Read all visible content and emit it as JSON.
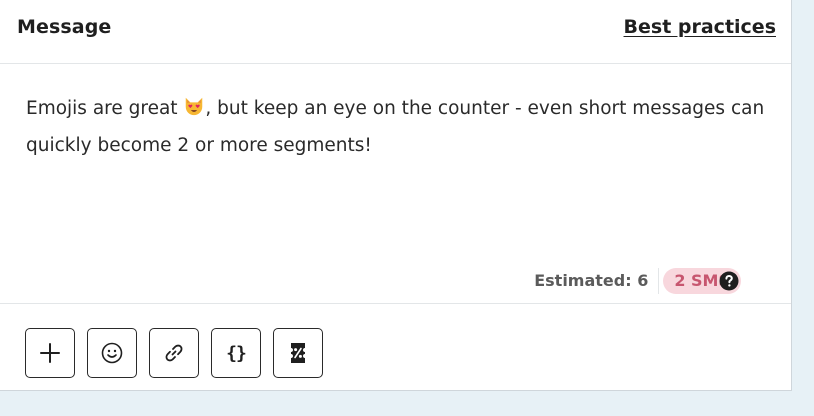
{
  "header": {
    "title": "Message",
    "link_label": "Best practices"
  },
  "message": {
    "text_before_emoji": "Emojis are great ",
    "emoji": "heart-eyes-cat-emoji",
    "text_after_emoji": ", but keep an eye on the counter - even short messages can quickly become 2 or more segments!"
  },
  "counter": {
    "estimated_label": "Estimated: 6",
    "sms_badge": "2 SMS",
    "help_icon": "question-circle-icon"
  },
  "toolbar": {
    "buttons": [
      {
        "icon": "plus-icon"
      },
      {
        "icon": "smiley-icon"
      },
      {
        "icon": "link-icon"
      },
      {
        "icon": "braces-icon",
        "label": "{}"
      },
      {
        "icon": "coupon-icon"
      }
    ]
  },
  "colors": {
    "background": "#e7f1f6",
    "badge_bg": "#f8d7dd",
    "badge_text": "#c7566f"
  }
}
